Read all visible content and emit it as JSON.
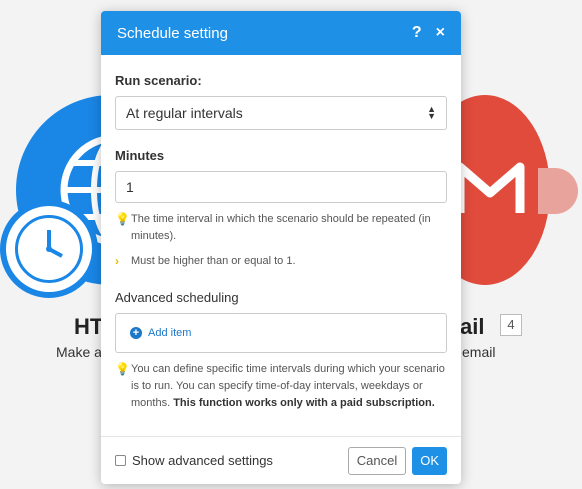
{
  "background": {
    "left_module": {
      "title": "HT",
      "subtitle": "Make a"
    },
    "right_module": {
      "title": "ail",
      "badge": "4",
      "subtitle": "email"
    }
  },
  "dialog": {
    "title": "Schedule setting",
    "help_icon": "?",
    "close_icon": "×",
    "run_scenario": {
      "label": "Run scenario:",
      "selected": "At regular intervals",
      "arrows": "▲▼"
    },
    "minutes": {
      "label": "Minutes",
      "value": "1",
      "hint": "The time interval in which the scenario should be repeated (in minutes).",
      "validation": "Must be higher than or equal to 1."
    },
    "advanced_scheduling": {
      "label": "Advanced scheduling",
      "add_item": "Add item",
      "hint": "You can define specific time intervals during which your scenario is to run. You can specify time-of-day intervals, weekdays or months.",
      "hint_bold": "This function works only with a paid subscription."
    },
    "footer": {
      "show_advanced": "Show advanced settings",
      "cancel": "Cancel",
      "ok": "OK"
    }
  },
  "colors": {
    "accent": "#1e90e6",
    "link": "#1e78c8",
    "hint_icon": "#e6b800"
  },
  "icons": [
    "help-icon",
    "close-icon",
    "select-arrows-icon",
    "lightbulb-icon",
    "chevron-right-icon",
    "plus-circle-icon",
    "checkbox-icon",
    "clock-icon"
  ]
}
